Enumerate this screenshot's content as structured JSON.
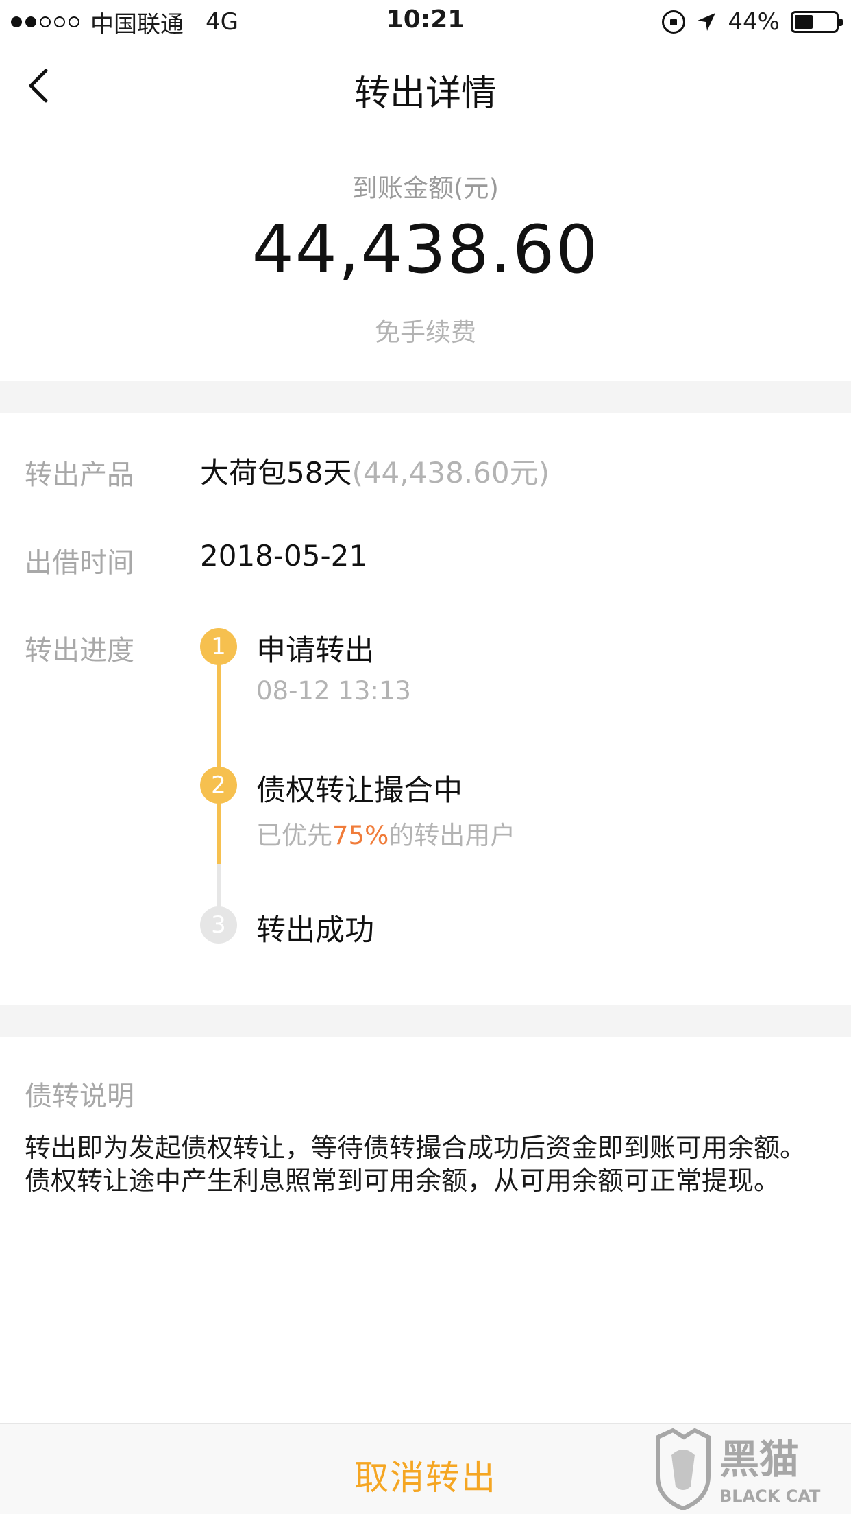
{
  "status_bar": {
    "carrier": "中国联通",
    "network": "4G",
    "time": "10:21",
    "battery": "44%",
    "battery_level": 0.44,
    "signal_bars_filled": 2,
    "signal_bars_total": 5
  },
  "nav": {
    "title": "转出详情",
    "back_icon": "chevron-left-icon"
  },
  "amount": {
    "label": "到账金额(元)",
    "value": "44,438.60",
    "fee_note": "免手续费"
  },
  "details": {
    "product_label": "转出产品",
    "product_name": "大荷包58天",
    "product_amount": "(44,438.60元)",
    "date_label": "出借时间",
    "date_value": "2018-05-21",
    "progress_label": "转出进度"
  },
  "steps": [
    {
      "num": "1",
      "title": "申请转出",
      "sub": "08-12 13:13",
      "done": true
    },
    {
      "num": "2",
      "title": "债权转让撮合中",
      "sub_prefix": "已优先",
      "sub_highlight": "75%",
      "sub_suffix": "的转出用户",
      "done": true
    },
    {
      "num": "3",
      "title": "转出成功",
      "done": false
    }
  ],
  "note": {
    "title": "债转说明",
    "body": "转出即为发起债权转让，等待债转撮合成功后资金即到账可用余额。债权转让途中产生利息照常到可用余额，从可用余额可正常提现。"
  },
  "bottom": {
    "cancel_label": "取消转出"
  },
  "watermark": {
    "cn": "黑猫",
    "en": "BLACK CAT"
  },
  "colors": {
    "accent": "#f5a623",
    "step_active": "#f6c04f",
    "step_inactive": "#e6e6e6",
    "highlight": "#f07c3a",
    "muted_text": "#a8a8a8",
    "divider": "#f4f4f4"
  }
}
